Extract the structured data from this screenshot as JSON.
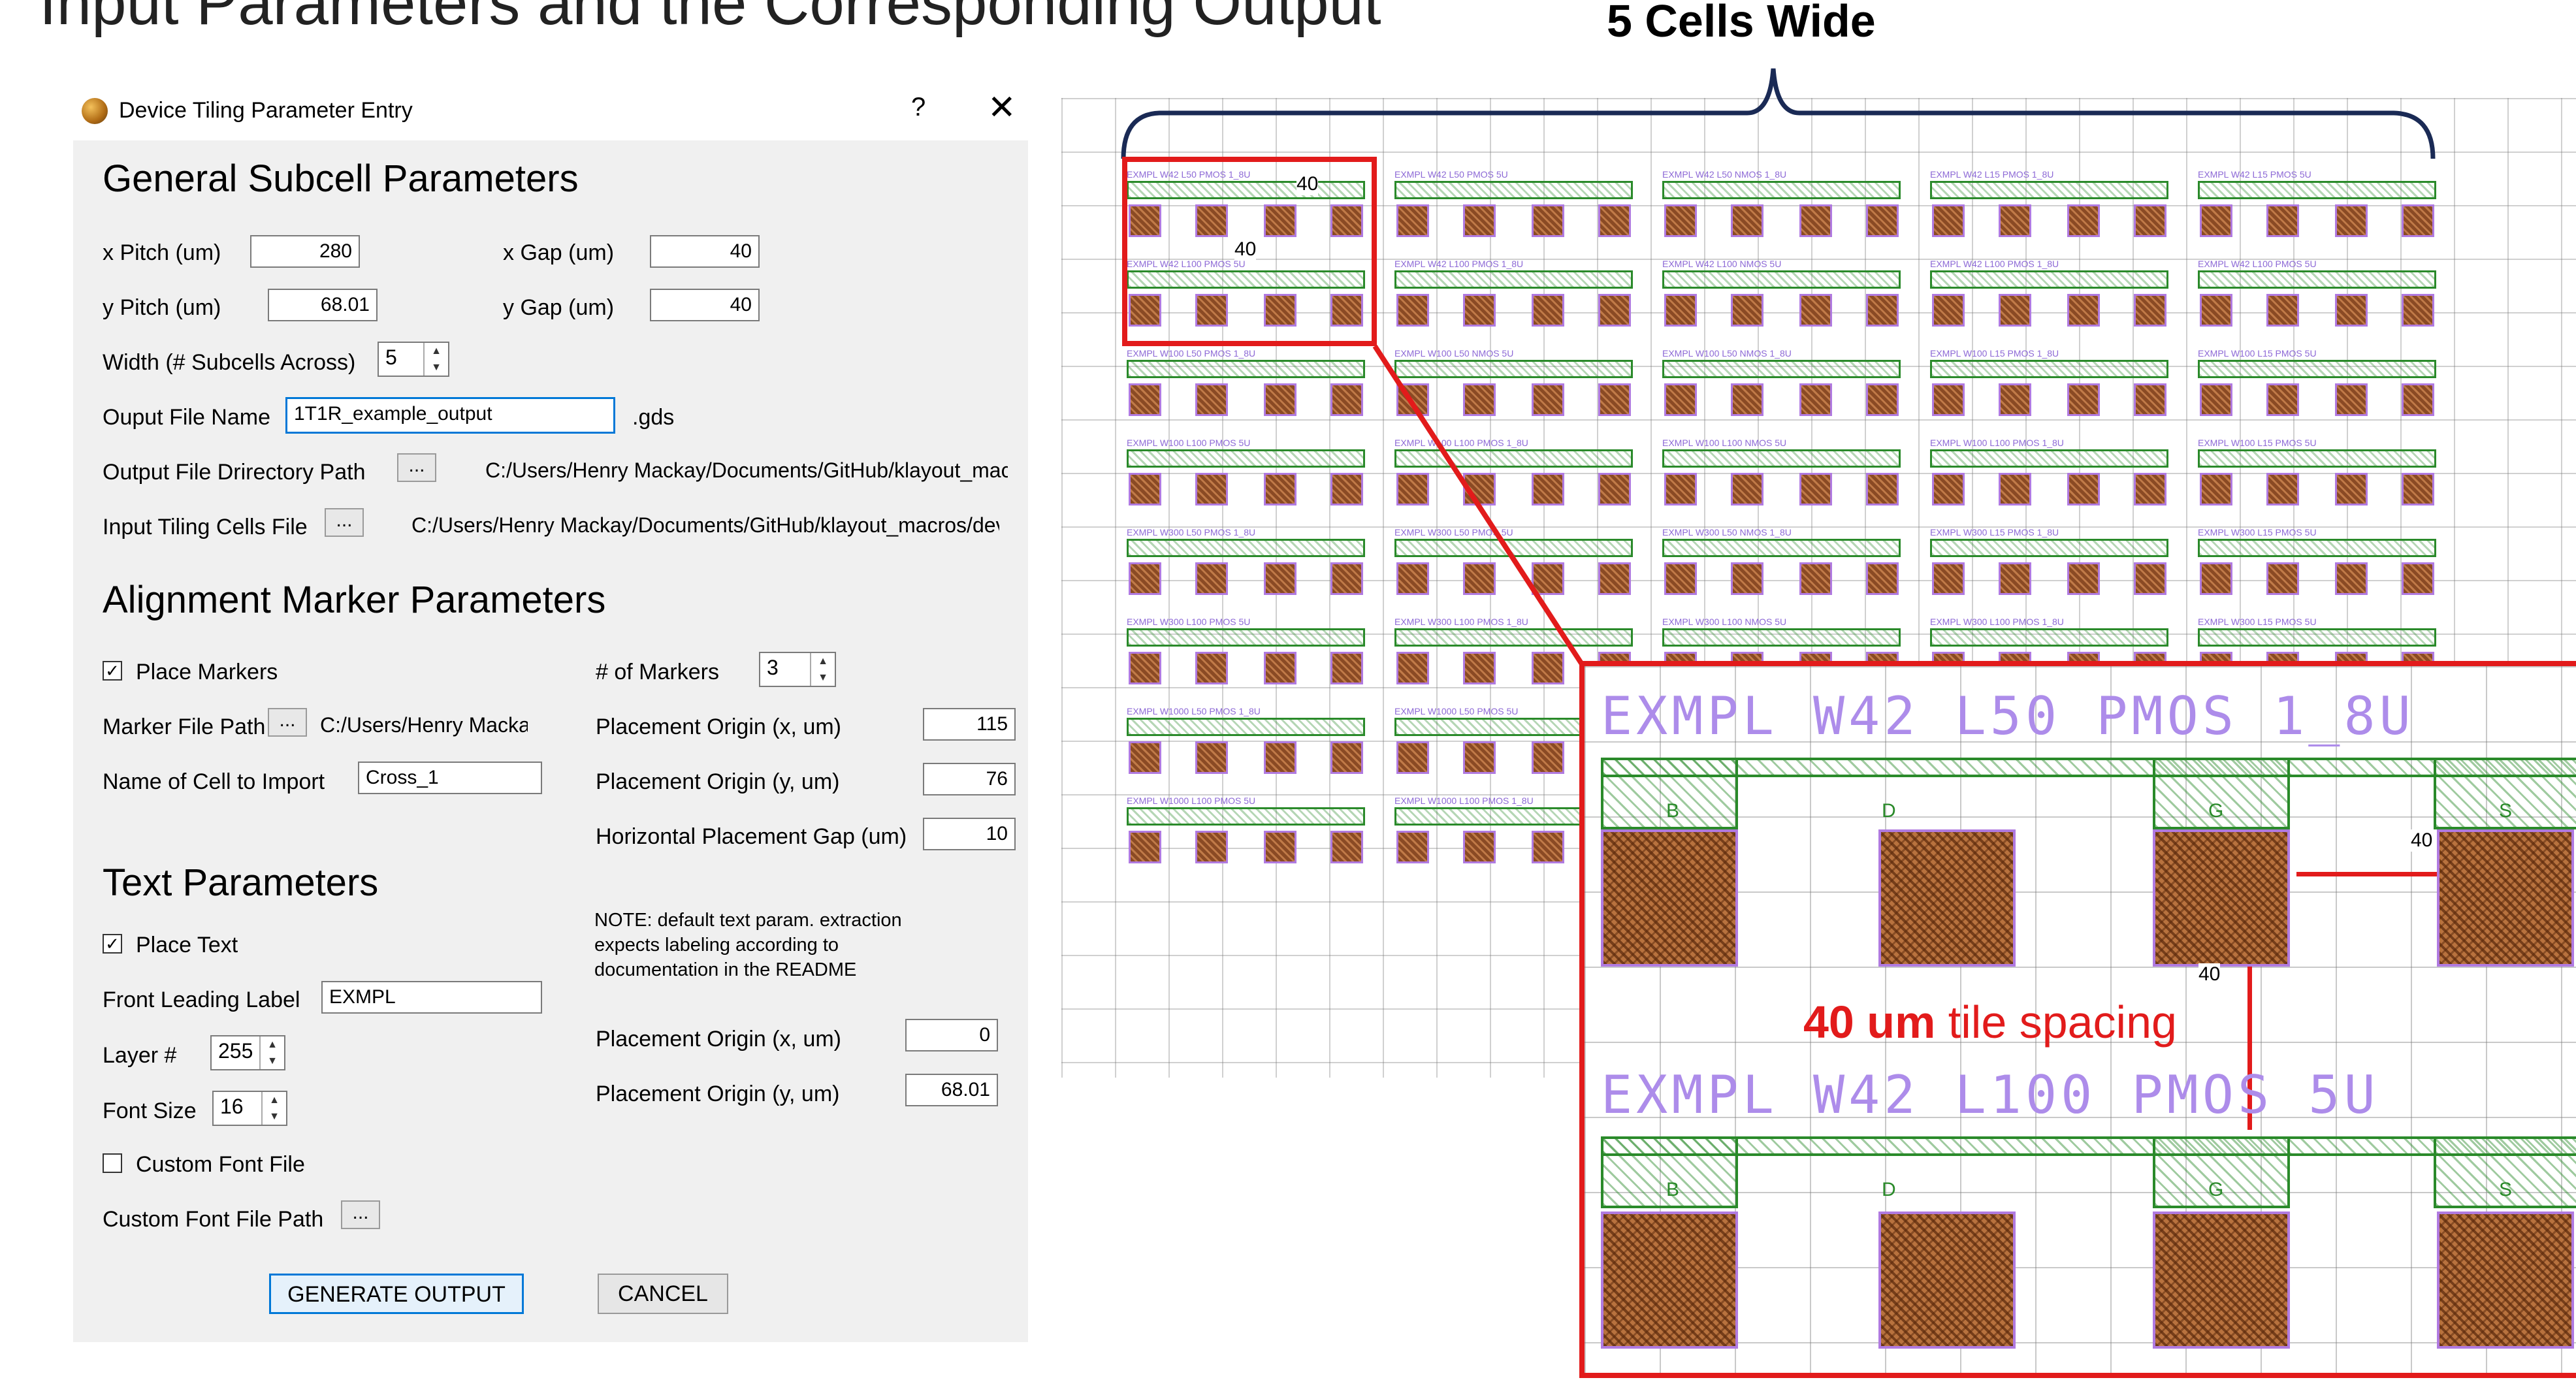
{
  "slide": {
    "title": "Input Parameters and the Corresponding Output",
    "cells_wide_label": "5 Cells Wide"
  },
  "dialog": {
    "title": "Device Tiling Parameter Entry",
    "help": "?",
    "close": "✕",
    "general": {
      "heading": "General Subcell Parameters",
      "x_pitch_label": "x Pitch (um)",
      "x_pitch": "280",
      "x_gap_label": "x Gap (um)",
      "x_gap": "40",
      "y_pitch_label": "y Pitch (um)",
      "y_pitch": "68.01",
      "y_gap_label": "y Gap (um)",
      "y_gap": "40",
      "width_label": "Width (# Subcells Across)",
      "width": "5",
      "output_name_label": "Ouput File Name",
      "output_name": "1T1R_example_output",
      "output_ext": ".gds",
      "output_dir_label": "Output File Drirectory Path",
      "output_dir": "C:/Users/Henry Mackay/Documents/GitHub/klayout_macro",
      "input_cells_label": "Input Tiling Cells File",
      "input_cells": "C:/Users/Henry Mackay/Documents/GitHub/klayout_macros/device",
      "browse": "..."
    },
    "alignment": {
      "heading": "Alignment Marker Parameters",
      "place_markers_label": "Place Markers",
      "place_markers": true,
      "marker_path_label": "Marker File Path",
      "marker_path": "C:/Users/Henry Mackay",
      "cell_import_label": "Name of Cell to Import",
      "cell_import": "Cross_1",
      "num_markers_label": "# of Markers",
      "num_markers": "3",
      "origin_x_label": "Placement Origin (x, um)",
      "origin_x": "115",
      "origin_y_label": "Placement Origin (y, um)",
      "origin_y": "76",
      "hgap_label": "Horizontal Placement Gap (um)",
      "hgap": "10"
    },
    "text": {
      "heading": "Text Parameters",
      "place_text_label": "Place Text",
      "place_text": true,
      "leading_label": "Front Leading Label",
      "leading": "EXMPL",
      "layer_label": "Layer #",
      "layer": "255",
      "font_size_label": "Font Size",
      "font_size": "16",
      "custom_font_label": "Custom Font File",
      "custom_font": false,
      "custom_font_path_label": "Custom Font File Path",
      "note": "NOTE: default text param. extraction expects labeling according to documentation in the README",
      "origin_x_label": "Placement Origin (x, um)",
      "origin_x": "0",
      "origin_y_label": "Placement Origin (y, um)",
      "origin_y": "68.01"
    },
    "buttons": {
      "generate": "GENERATE OUTPUT",
      "cancel": "CANCEL"
    }
  },
  "layout": {
    "cell_labels": [
      [
        "EXMPL W42 L50 PMOS 1_8U",
        "EXMPL W42 L50 PMOS 5U",
        "EXMPL W42 L50 NMOS 1_8U",
        "EXMPL W42 L15 PMOS 1_8U",
        "EXMPL W42 L15 PMOS 5U"
      ],
      [
        "EXMPL W42 L100 PMOS 5U",
        "EXMPL W42 L100 PMOS 1_8U",
        "EXMPL W42 L100 NMOS 5U",
        "EXMPL W42 L100 PMOS 1_8U",
        "EXMPL W42 L100 PMOS 5U"
      ],
      [
        "EXMPL W100 L50 PMOS 1_8U",
        "EXMPL W100 L50 NMOS 5U",
        "EXMPL W100 L50 NMOS 1_8U",
        "EXMPL W100 L15 PMOS 1_8U",
        "EXMPL W100 L15 PMOS 5U"
      ],
      [
        "EXMPL W100 L100 PMOS 5U",
        "EXMPL W100 L100 PMOS 1_8U",
        "EXMPL W100 L100 NMOS 5U",
        "EXMPL W100 L100 PMOS 1_8U",
        "EXMPL W100 L15 PMOS 5U"
      ],
      [
        "EXMPL W300 L50 PMOS 1_8U",
        "EXMPL W300 L50 PMOS 5U",
        "EXMPL W300 L50 NMOS 1_8U",
        "EXMPL W300 L15 PMOS 1_8U",
        "EXMPL W300 L15 PMOS 5U"
      ],
      [
        "EXMPL W300 L100 PMOS 5U",
        "EXMPL W300 L100 PMOS 1_8U",
        "EXMPL W300 L100 NMOS 5U",
        "EXMPL W300 L100 PMOS 1_8U",
        "EXMPL W300 L15 PMOS 5U"
      ],
      [
        "EXMPL W1000 L50 PMOS 1_8U",
        "EXMPL W1000 L50 PMOS 5U",
        "",
        "",
        ""
      ],
      [
        "EXMPL W1000 L100 PMOS 5U",
        "EXMPL W1000 L100 PMOS 1_8U",
        "",
        "",
        ""
      ]
    ],
    "dim_x": "40",
    "dim_y": "40",
    "zoom": {
      "label_top": "EXMPL  W42  L50  PMOS  1_8U",
      "label_bottom": "EXMPL  W42  L100  PMOS  5U",
      "terminals": [
        "B",
        "D",
        "G",
        "S"
      ],
      "dim_h": "40",
      "dim_v": "40",
      "spacing_bold": "40 um",
      "spacing_rest": " tile spacing"
    }
  },
  "colors": {
    "accent_red": "#e21b1b",
    "metal_green": "#2a8a2a",
    "label_purple": "#ad8cea",
    "pad_brown": "#b8723e",
    "focus_blue": "#0078d7"
  }
}
